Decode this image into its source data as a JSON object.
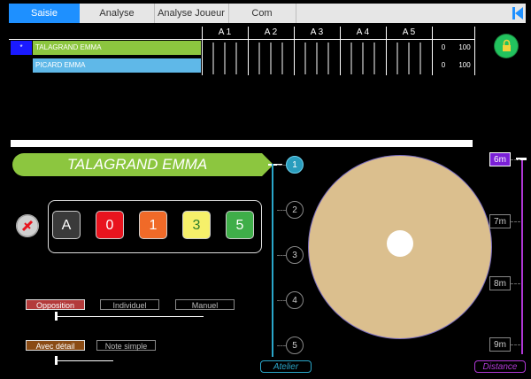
{
  "tabs": [
    {
      "label": "Saisie",
      "active": true
    },
    {
      "label": "Analyse",
      "active": false
    },
    {
      "label": "Analyse Joueur",
      "active": false
    },
    {
      "label": "Com",
      "active": false
    }
  ],
  "grid": {
    "columns": [
      "A 1",
      "A 2",
      "A 3",
      "A 4",
      "A 5"
    ],
    "rows": [
      {
        "marker": "*",
        "name": "TALAGRAND EMMA",
        "count": "0",
        "percent": "100",
        "color": "#8cc63f"
      },
      {
        "marker": "",
        "name": "PICARD EMMA",
        "count": "0",
        "percent": "100",
        "color": "#5fb8e8"
      }
    ]
  },
  "player": {
    "name": "TALAGRAND  EMMA"
  },
  "scores": [
    {
      "label": "A",
      "bg": "#3a3a3a",
      "fg": "#ffffff"
    },
    {
      "label": "0",
      "bg": "#e8141e",
      "fg": "#ffffff"
    },
    {
      "label": "1",
      "bg": "#f06a28",
      "fg": "#ffffff"
    },
    {
      "label": "3",
      "bg": "#f6f06a",
      "fg": "#2a7d2a"
    },
    {
      "label": "5",
      "bg": "#3fae49",
      "fg": "#ffffff"
    }
  ],
  "options": {
    "mode": [
      "Opposition",
      "Individuel",
      "Manuel"
    ],
    "detail": [
      "Avec détail",
      "Note simple"
    ]
  },
  "atelier": {
    "steps": [
      "1",
      "2",
      "3",
      "4",
      "5"
    ],
    "active_index": 0,
    "label": "Atelier"
  },
  "distance": {
    "values": [
      "6m",
      "7m",
      "8m",
      "9m"
    ],
    "active_index": 0,
    "label": "Distance"
  },
  "colors": {
    "accent": "#1e90ff",
    "player": "#8cc63f",
    "atelier": "#2aa6c9",
    "distance": "#b038d6",
    "target": "#dbbf8e"
  }
}
